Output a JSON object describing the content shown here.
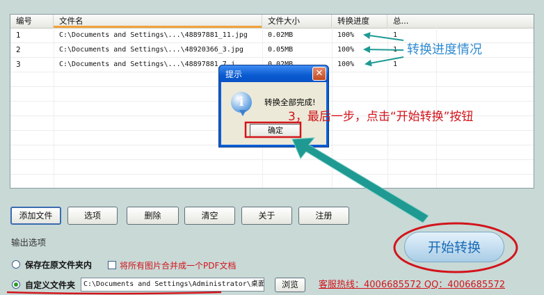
{
  "columns": [
    "编号",
    "文件名",
    "文件大小",
    "转换进度",
    "总..."
  ],
  "rows": [
    {
      "id": "1",
      "name": "C:\\Documents and Settings\\...\\48897881_11.jpg",
      "size": "0.02MB",
      "progress": "100%",
      "total": "1"
    },
    {
      "id": "2",
      "name": "C:\\Documents and Settings\\...\\48920366_3.jpg",
      "size": "0.05MB",
      "progress": "100%",
      "total": "1"
    },
    {
      "id": "3",
      "name": "C:\\Documents and Settings\\...\\48897881_7.j",
      "size": "0.02MB",
      "progress": "100%",
      "total": "1"
    }
  ],
  "toolbar": {
    "add": "添加文件",
    "options": "选项",
    "delete": "删除",
    "clear": "清空",
    "about": "关于",
    "register": "注册"
  },
  "output": {
    "section_title": "输出选项",
    "save_original": "保存在原文件夹内",
    "merge_pdf": "将所有图片合并成一个PDF文档",
    "custom_folder": "自定义文件夹",
    "path_value": "C:\\Documents and Settings\\Administrator\\桌面",
    "browse": "浏览",
    "hotline": "客服热线：4006685572 QQ：4006685572"
  },
  "start_button": "开始转换",
  "dialog": {
    "title": "提示",
    "message": "转换全部完成!",
    "ok": "确定",
    "close_glyph": "✕",
    "icon_glyph": "i"
  },
  "annotations": {
    "progress_note": "转换进度情况",
    "step_note": "3，最后一步，点击“开始转换”按钮"
  },
  "colors": {
    "annotation_red": "#d2141b",
    "annotation_blue": "#2f8ad0",
    "arrow_teal": "#1f9a93",
    "titlebar_blue": "#0a5ed4"
  }
}
